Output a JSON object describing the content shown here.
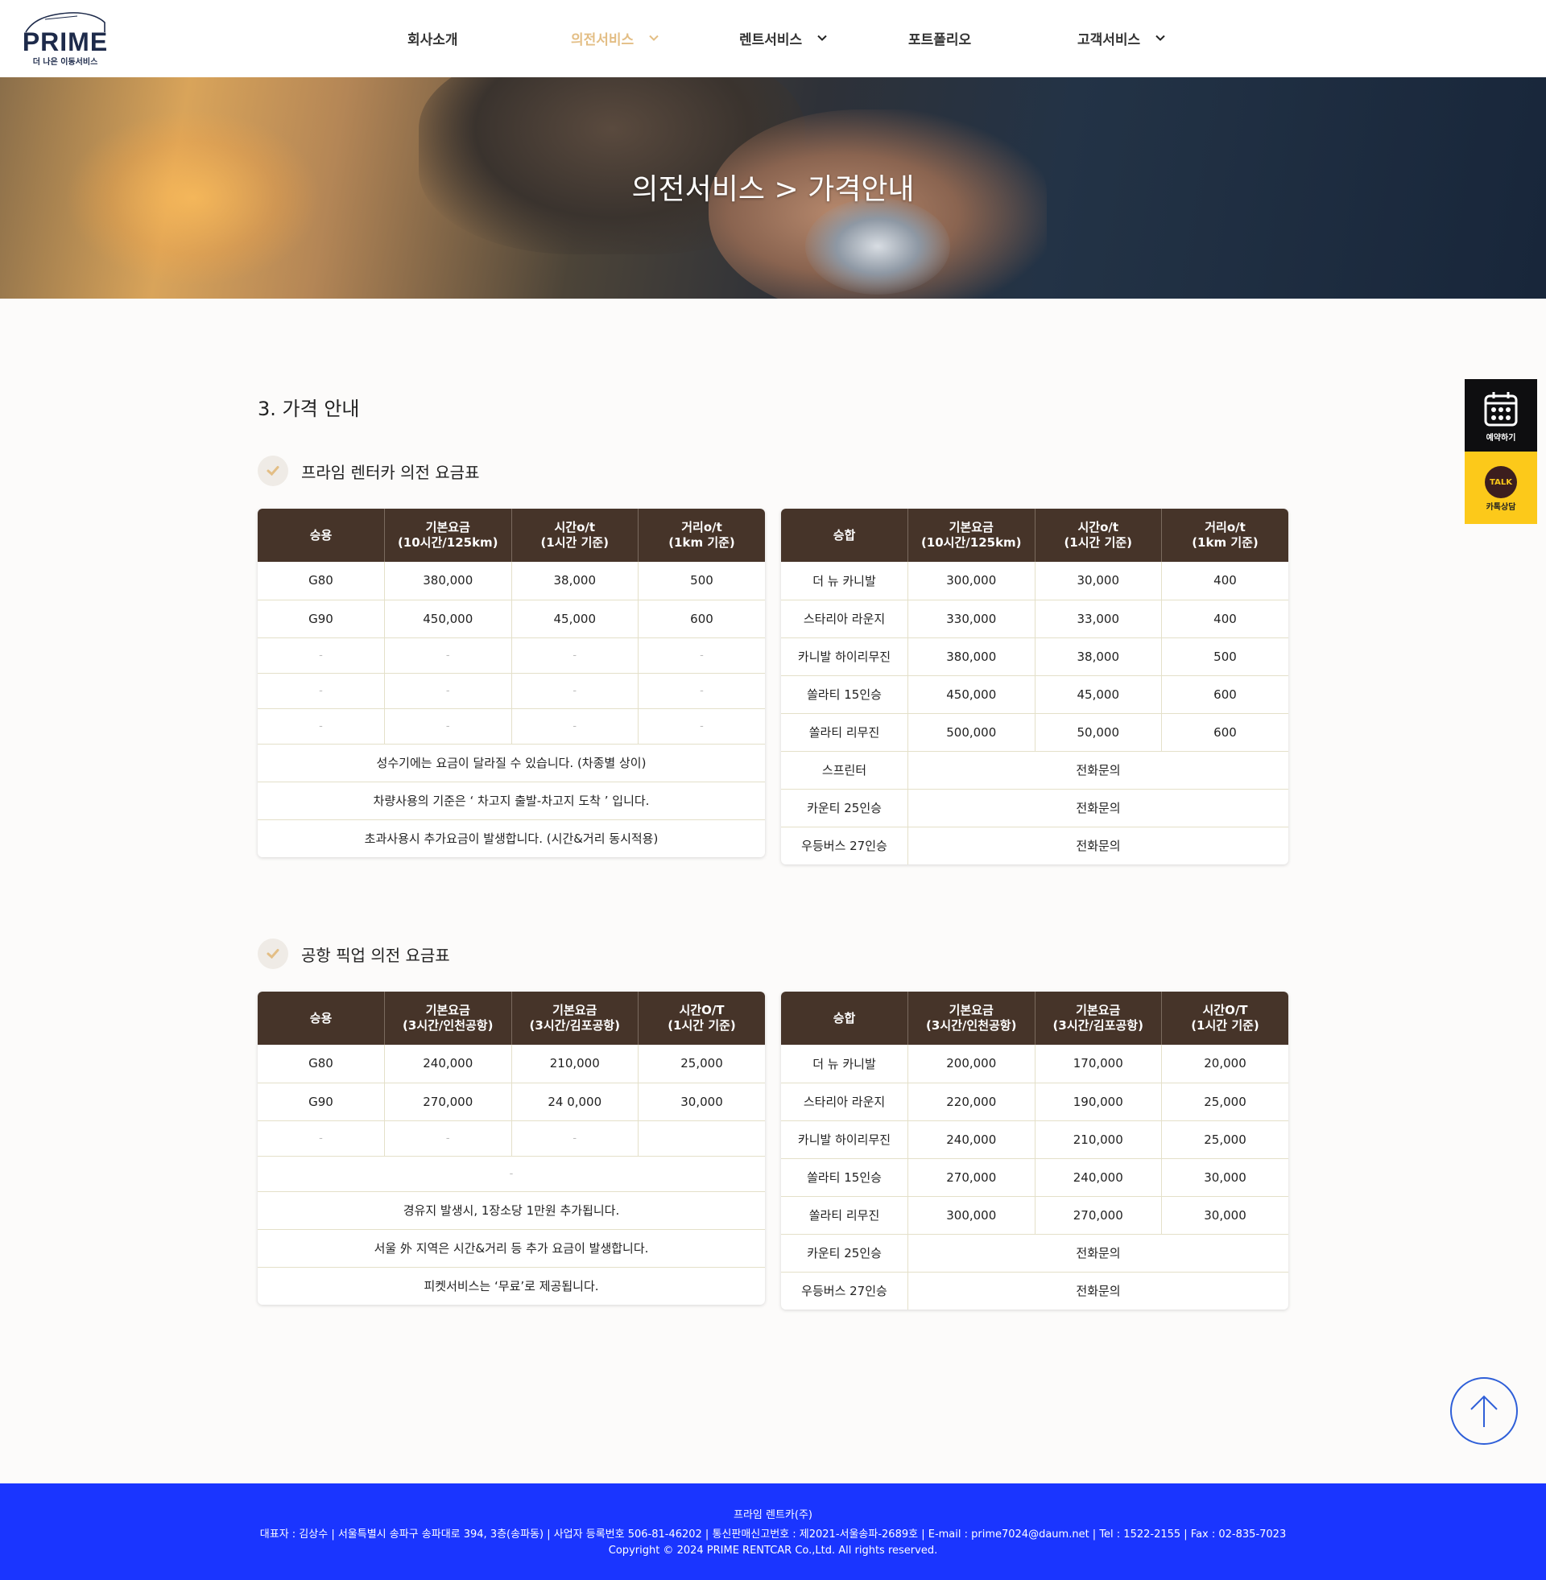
{
  "header": {
    "logo_text": "PRIME",
    "logo_tagline": "더 나은 이동서비스",
    "nav": [
      {
        "label": "회사소개",
        "has_dropdown": false
      },
      {
        "label": "의전서비스",
        "has_dropdown": true,
        "active": true
      },
      {
        "label": "렌트서비스",
        "has_dropdown": true
      },
      {
        "label": "포트폴리오",
        "has_dropdown": false
      },
      {
        "label": "고객서비스",
        "has_dropdown": true
      }
    ]
  },
  "hero": {
    "title": "의전서비스 > 가격안내"
  },
  "content": {
    "section_title": "3. 가격 안내",
    "table1_heading": "프라임 렌터카 의전 요금표",
    "table2_heading": "공항 픽업 의전 요금표"
  },
  "table1_left": {
    "headers": [
      "승용",
      "기본요금\n(10시간/125km)",
      "시간o/t\n(1시간 기준)",
      "거리o/t\n(1km 기준)"
    ],
    "rows": [
      [
        "G80",
        "380,000",
        "38,000",
        "500"
      ],
      [
        "G90",
        "450,000",
        "45,000",
        "600"
      ],
      [
        "-",
        "-",
        "-",
        "-"
      ],
      [
        "-",
        "-",
        "-",
        "-"
      ],
      [
        "-",
        "-",
        "-",
        "-"
      ]
    ],
    "notes": [
      "성수기에는 요금이 달라질 수 있습니다. (차종별 상이)",
      "차량사용의 기준은 ‘ 차고지 출발-차고지 도착 ’ 입니다.",
      "초과사용시 추가요금이 발생합니다. (시간&거리 동시적용)"
    ]
  },
  "table1_right": {
    "headers": [
      "승합",
      "기본요금\n(10시간/125km)",
      "시간o/t\n(1시간 기준)",
      "거리o/t\n(1km 기준)"
    ],
    "rows": [
      [
        "더 뉴 카니발",
        "300,000",
        "30,000",
        "400"
      ],
      [
        "스타리아 라운지",
        "330,000",
        "33,000",
        "400"
      ],
      [
        "카니발 하이리무진",
        "380,000",
        "38,000",
        "500"
      ],
      [
        "쏠라티 15인승",
        "450,000",
        "45,000",
        "600"
      ],
      [
        "쏠라티 리무진",
        "500,000",
        "50,000",
        "600"
      ]
    ],
    "inquiry_rows": [
      [
        "스프린터",
        "전화문의"
      ],
      [
        "카운티 25인승",
        "전화문의"
      ],
      [
        "우등버스 27인승",
        "전화문의"
      ]
    ]
  },
  "table2_left": {
    "headers": [
      "승용",
      "기본요금\n(3시간/인천공항)",
      "기본요금\n(3시간/김포공항)",
      "시간O/T\n(1시간 기준)"
    ],
    "rows": [
      [
        "G80",
        "240,000",
        "210,000",
        "25,000"
      ],
      [
        "G90",
        "270,000",
        "24 0,000",
        "30,000"
      ],
      [
        "-",
        "-",
        "-",
        ""
      ]
    ],
    "notes": [
      "-",
      "경유지 발생시, 1장소당 1만원 추가됩니다.",
      "서울 外 지역은 시간&거리 등 추가 요금이 발생합니다.",
      "피켓서비스는 ‘무료’로 제공됩니다."
    ]
  },
  "table2_right": {
    "headers": [
      "승합",
      "기본요금\n(3시간/인천공항)",
      "기본요금\n(3시간/김포공항)",
      "시간O/T\n(1시간 기준)"
    ],
    "rows": [
      [
        "더 뉴 카니발",
        "200,000",
        "170,000",
        "20,000"
      ],
      [
        "스타리아 라운지",
        "220,000",
        "190,000",
        "25,000"
      ],
      [
        "카니발 하이리무진",
        "240,000",
        "210,000",
        "25,000"
      ],
      [
        "쏠라티 15인승",
        "270,000",
        "240,000",
        "30,000"
      ],
      [
        "쏠라티 리무진",
        "300,000",
        "270,000",
        "30,000"
      ]
    ],
    "inquiry_rows": [
      [
        "카운티 25인승",
        "전화문의"
      ],
      [
        "우등버스 27인승",
        "전화문의"
      ]
    ]
  },
  "floating": {
    "book_label": "예약하기",
    "talk_bubble": "TALK",
    "talk_label": "카톡상담"
  },
  "footer": {
    "company": "프라임 렌트카(주)",
    "info": "대표자 : 김상수 | 서울특별시 송파구 송파대로 394, 3층(송파동) | 사업자 등록번호 506-81-46202 | 통신판매신고번호 : 제2021-서울송파-2689호 | E-mail : prime7024@daum.net | Tel : 1522-2155 | Fax : 02-835-7023",
    "copyright": "Copyright © 2024 PRIME RENTCAR Co.,Ltd. All rights reserved."
  },
  "colors": {
    "table_header": "#463429",
    "nav_active": "#e3be85",
    "footer_bg": "#1a35ff",
    "talk_yellow": "#fcc91a",
    "book_black": "#0e0e10"
  }
}
